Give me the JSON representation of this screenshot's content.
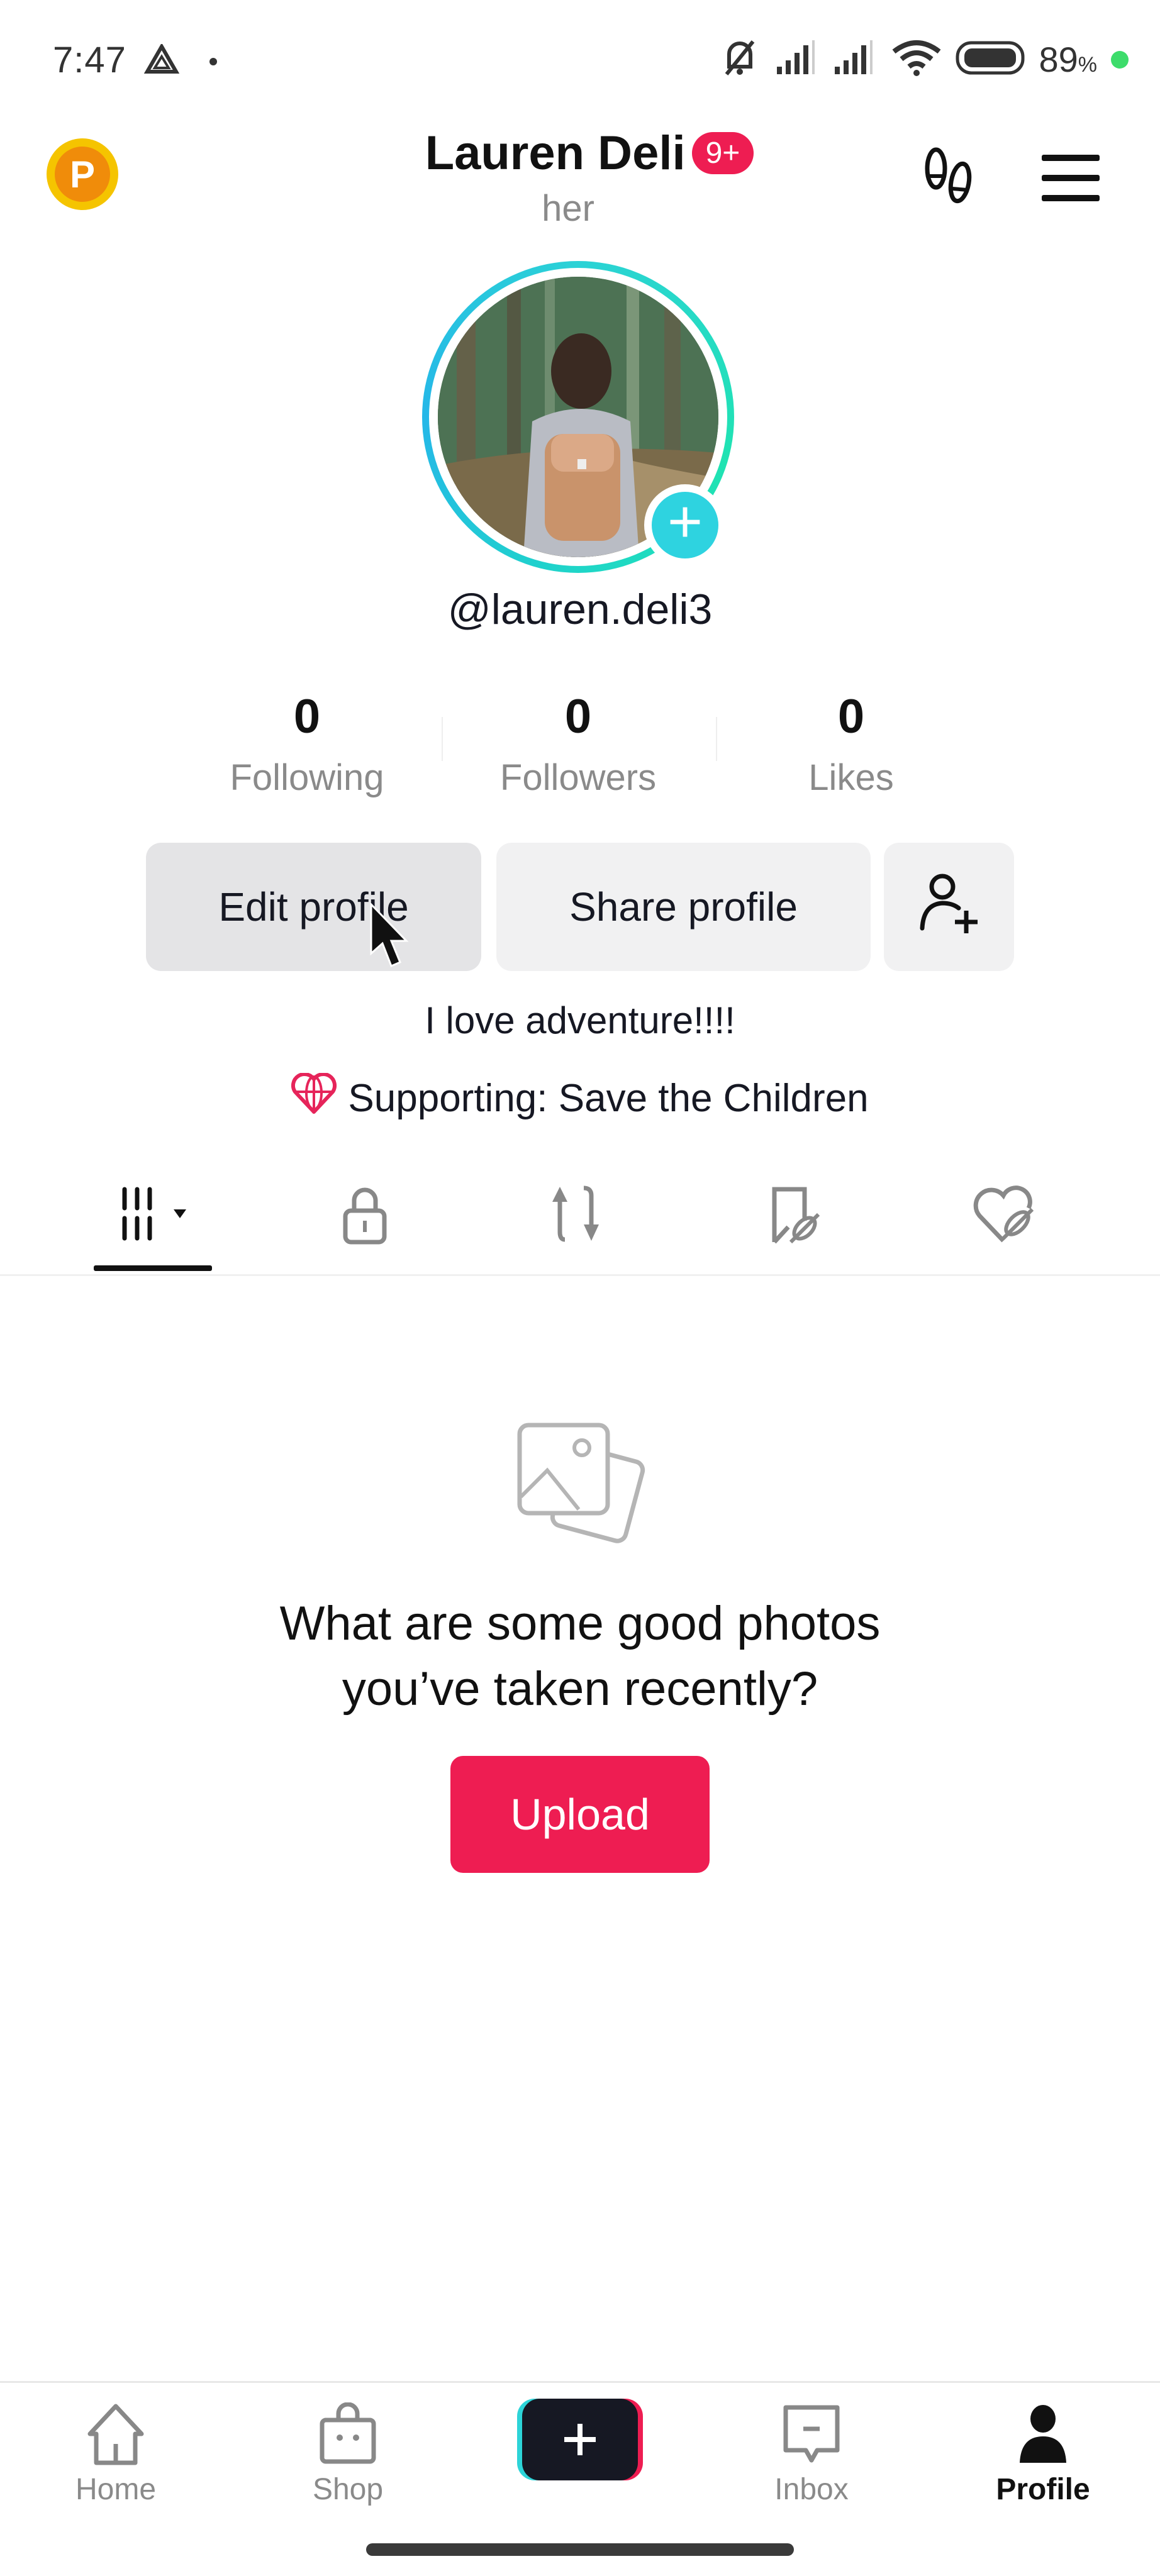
{
  "status_bar": {
    "time": "7:47",
    "battery_percent": "89",
    "battery_unit": "%",
    "icons": [
      "drive-icon",
      "dot",
      "mute-icon",
      "signal-icon",
      "signal-icon",
      "wifi-icon",
      "battery-icon",
      "charging-dot"
    ]
  },
  "header": {
    "coin_label": "P",
    "display_name": "Lauren Deli",
    "notification_badge": "9+",
    "pronoun": "her",
    "icons": [
      "footprint-icon",
      "menu-icon"
    ]
  },
  "profile": {
    "handle": "@lauren.deli3",
    "avatar_add_label": "+",
    "stats": [
      {
        "value": "0",
        "label": "Following"
      },
      {
        "value": "0",
        "label": "Followers"
      },
      {
        "value": "0",
        "label": "Likes"
      }
    ],
    "buttons": {
      "edit": "Edit profile",
      "share": "Share profile",
      "add_friend_icon": "add-friend-icon"
    },
    "bio": "I love adventure!!!!",
    "supporting": "Supporting: Save the Children"
  },
  "tabs": [
    {
      "name": "posts",
      "icon": "grid-icon",
      "active": true
    },
    {
      "name": "private",
      "icon": "lock-icon",
      "active": false
    },
    {
      "name": "reposts",
      "icon": "repost-icon",
      "active": false
    },
    {
      "name": "favorites",
      "icon": "bookmark-hidden-icon",
      "active": false
    },
    {
      "name": "liked",
      "icon": "heart-hidden-icon",
      "active": false
    }
  ],
  "empty_state": {
    "title_line1": "What are some good photos",
    "title_line2": "you’ve taken recently?",
    "button": "Upload"
  },
  "bottom_nav": [
    {
      "label": "Home",
      "icon": "home-icon",
      "active": false
    },
    {
      "label": "Shop",
      "icon": "shop-icon",
      "active": false
    },
    {
      "label": "",
      "icon": "create-icon",
      "active": false
    },
    {
      "label": "Inbox",
      "icon": "inbox-icon",
      "active": false
    },
    {
      "label": "Profile",
      "icon": "profile-icon",
      "active": true
    }
  ],
  "colors": {
    "accent": "#ee1d52",
    "ring_cyan": "#2bd2d6",
    "coin_gold": "#f5c400"
  }
}
